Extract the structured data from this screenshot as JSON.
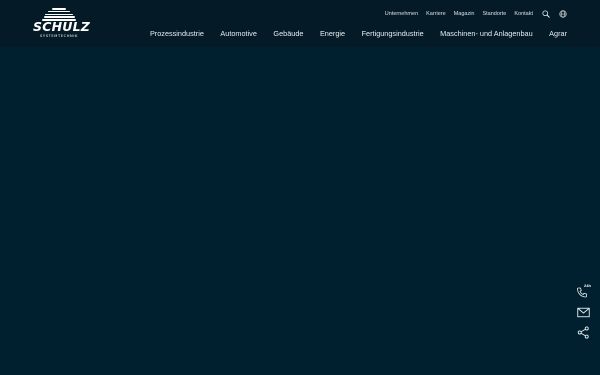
{
  "logo": {
    "name": "SCHULZ",
    "subtitle": "SYSTEMTECHNIK"
  },
  "meta_nav": {
    "items": [
      "Unternehmen",
      "Karriere",
      "Magazin",
      "Standorte",
      "Kontakt"
    ],
    "icons": [
      "search-icon",
      "globe-icon"
    ]
  },
  "main_nav": {
    "items": [
      "Prozessindustrie",
      "Automotive",
      "Gebäude",
      "Energie",
      "Fertigungsindustrie",
      "Maschinen- und Anlagenbau",
      "Agrar"
    ]
  },
  "side_actions": {
    "phone_badge": "24h",
    "icons": [
      "phone-24h-icon",
      "mail-icon",
      "share-icon"
    ]
  },
  "colors": {
    "header_bg": "#041a26",
    "page_bg": "#00202f",
    "text": "#e8eef2"
  }
}
